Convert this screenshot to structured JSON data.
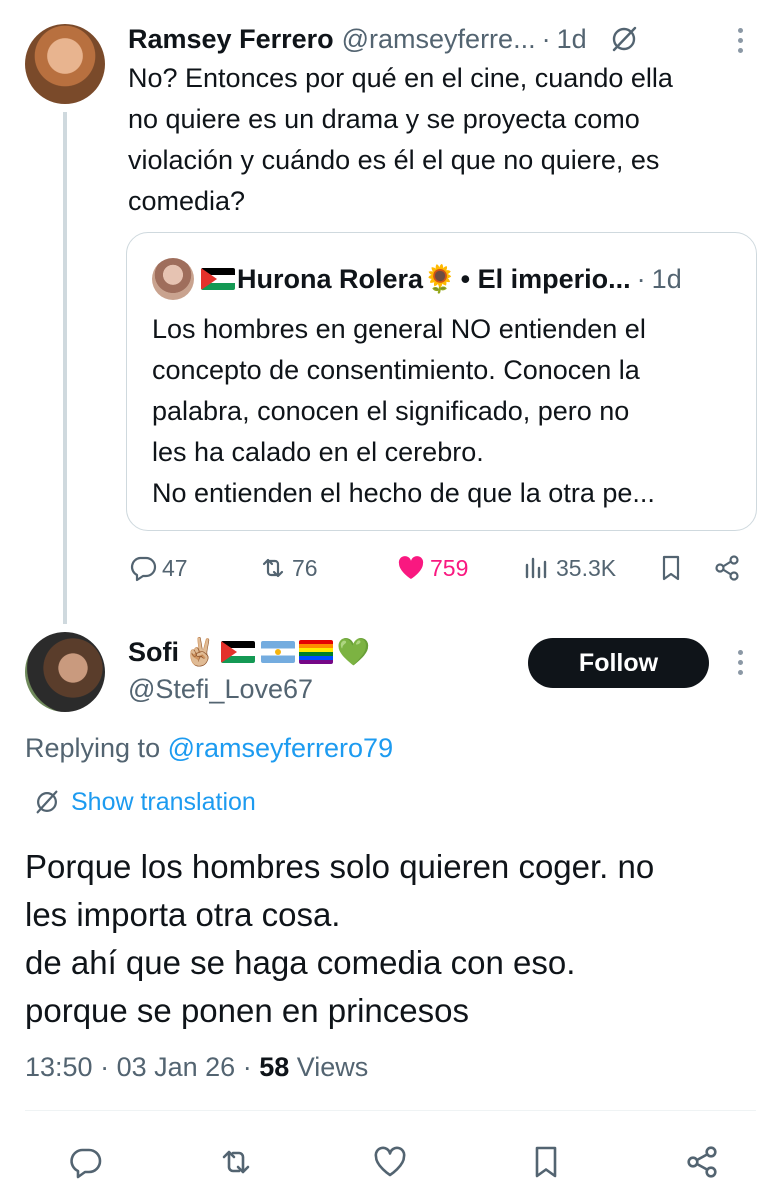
{
  "parent": {
    "name": "Ramsey Ferrero",
    "handle": "@ramseyferre...",
    "dot": "·",
    "time": "1d",
    "text": "No? Entonces por qué en el cine, cuando ella\nno quiere es un drama y se proyecta como\nviolación y cuándo es él el que no quiere, es\ncomedia?",
    "quote": {
      "name": "Hurona Rolera",
      "sunflower": "🌻",
      "suffix": "• El imperio...",
      "dot": "·",
      "time": "1d",
      "text": "Los hombres en general NO entienden el\nconcepto de consentimiento. Conocen la\npalabra, conocen el significado, pero no\nles ha calado en el cerebro.\nNo entienden el hecho de que la otra pe..."
    },
    "stats": {
      "replies": "47",
      "reposts": "76",
      "likes": "759",
      "views": "35.3K"
    }
  },
  "reply": {
    "name": "Sofi",
    "name_emoji": "✌🏼",
    "heart": "💚",
    "handle": "@Stefi_Love67",
    "follow_label": "Follow",
    "replying_prefix": "Replying to",
    "replying_mention": "@ramseyferrero79",
    "translate_label": "Show translation",
    "text": "Porque los hombres solo quieren coger. no\nles importa otra cosa.\nde ahí que se haga comedia con eso.\nporque se ponen en princesos",
    "time": "13:50",
    "sep1": " · ",
    "date": "03 Jan 26",
    "sep2": " · ",
    "views_count": "58",
    "views_label": " Views"
  },
  "colors": {
    "text": "#0f1419",
    "muted": "#536471",
    "link": "#1d9bf0",
    "like": "#f91880",
    "line": "#cfd9de"
  },
  "icons": [
    "grok-icon",
    "more-icon",
    "reply-icon",
    "repost-icon",
    "heart-icon",
    "views-icon",
    "bookmark-icon",
    "share-icon",
    "translate-icon"
  ]
}
